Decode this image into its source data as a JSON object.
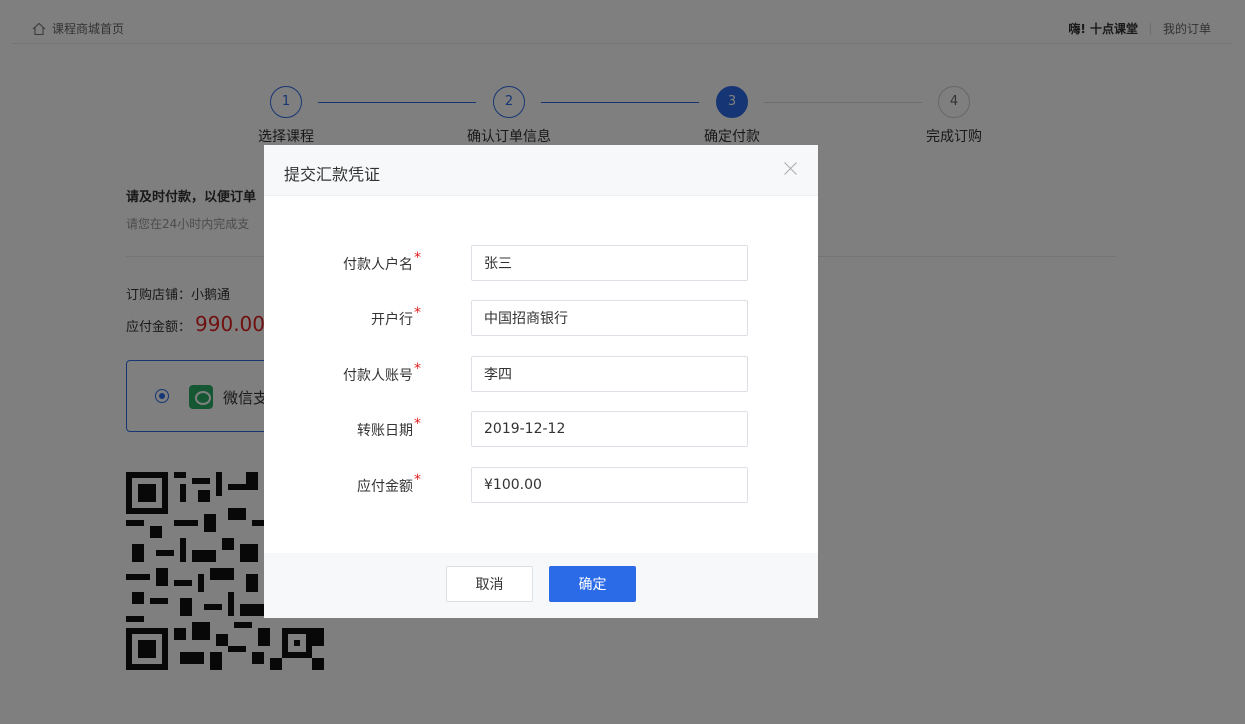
{
  "topbar": {
    "home_label": "课程商城首页",
    "greeting": "嗨! 十点课堂",
    "my_orders": "我的订单"
  },
  "steps": [
    {
      "number": "1",
      "label": "选择课程",
      "state": "done"
    },
    {
      "number": "2",
      "label": "确认订单信息",
      "state": "done"
    },
    {
      "number": "3",
      "label": "确定付款",
      "state": "active"
    },
    {
      "number": "4",
      "label": "完成订购",
      "state": "todo"
    }
  ],
  "payment": {
    "title": "请及时付款，以便订单",
    "subtitle": "请您在24小时内完成支",
    "shop": "订购店铺：小鹅通",
    "amount_label": "应付金额：",
    "amount_value": "990.00",
    "method": "微信支"
  },
  "modal": {
    "title": "提交汇款凭证",
    "fields": [
      {
        "label": "付款人户名",
        "value": "张三"
      },
      {
        "label": "开户行",
        "value": "中国招商银行"
      },
      {
        "label": "付款人账号",
        "value": "李四"
      },
      {
        "label": "转账日期",
        "value": "2019-12-12"
      },
      {
        "label": "应付金额",
        "value": "¥100.00"
      }
    ],
    "required_mark": "*",
    "cancel": "取消",
    "confirm": "确定"
  },
  "colors": {
    "accent": "#2b6be8",
    "price": "#e02020",
    "wechat": "#2aae67"
  }
}
